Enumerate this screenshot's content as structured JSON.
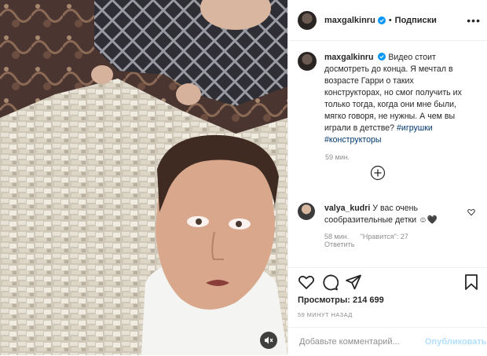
{
  "post": {
    "username": "maxgalkinru",
    "separator": "•",
    "follow_label": "Подписки",
    "more_icon": "more-horizontal-icon",
    "caption_username": "maxgalkinru",
    "caption_text": "Видео стоит досмотреть до конца. Я мечтал в возрасте Гарри о таких конструкторах, но смог получить их только тогда, когда они мне были, мягко говоря, не нужны. А чем вы играли в детстве?",
    "hashtag_1": "#игрушки",
    "hashtag_2": "#конструкторы",
    "caption_time": "59 мин."
  },
  "comment": {
    "username": "valya_kudri",
    "text": "У вас очень сообразительные детки",
    "emoji": "☺🖤",
    "time": "58 мин.",
    "likes": "\"Нравится\": 27",
    "reply_label": "Ответить"
  },
  "stats": {
    "views": "Просмотры: 214 699",
    "posted_ago": "59 МИНУТ НАЗАД"
  },
  "composer": {
    "placeholder": "Добавьте комментарий...",
    "publish_label": "Опубликовать"
  },
  "colors": {
    "verified": "#0095f6",
    "link": "#00376b",
    "muted": "#8e8e8e",
    "publish_disabled": "#b2dffc"
  }
}
